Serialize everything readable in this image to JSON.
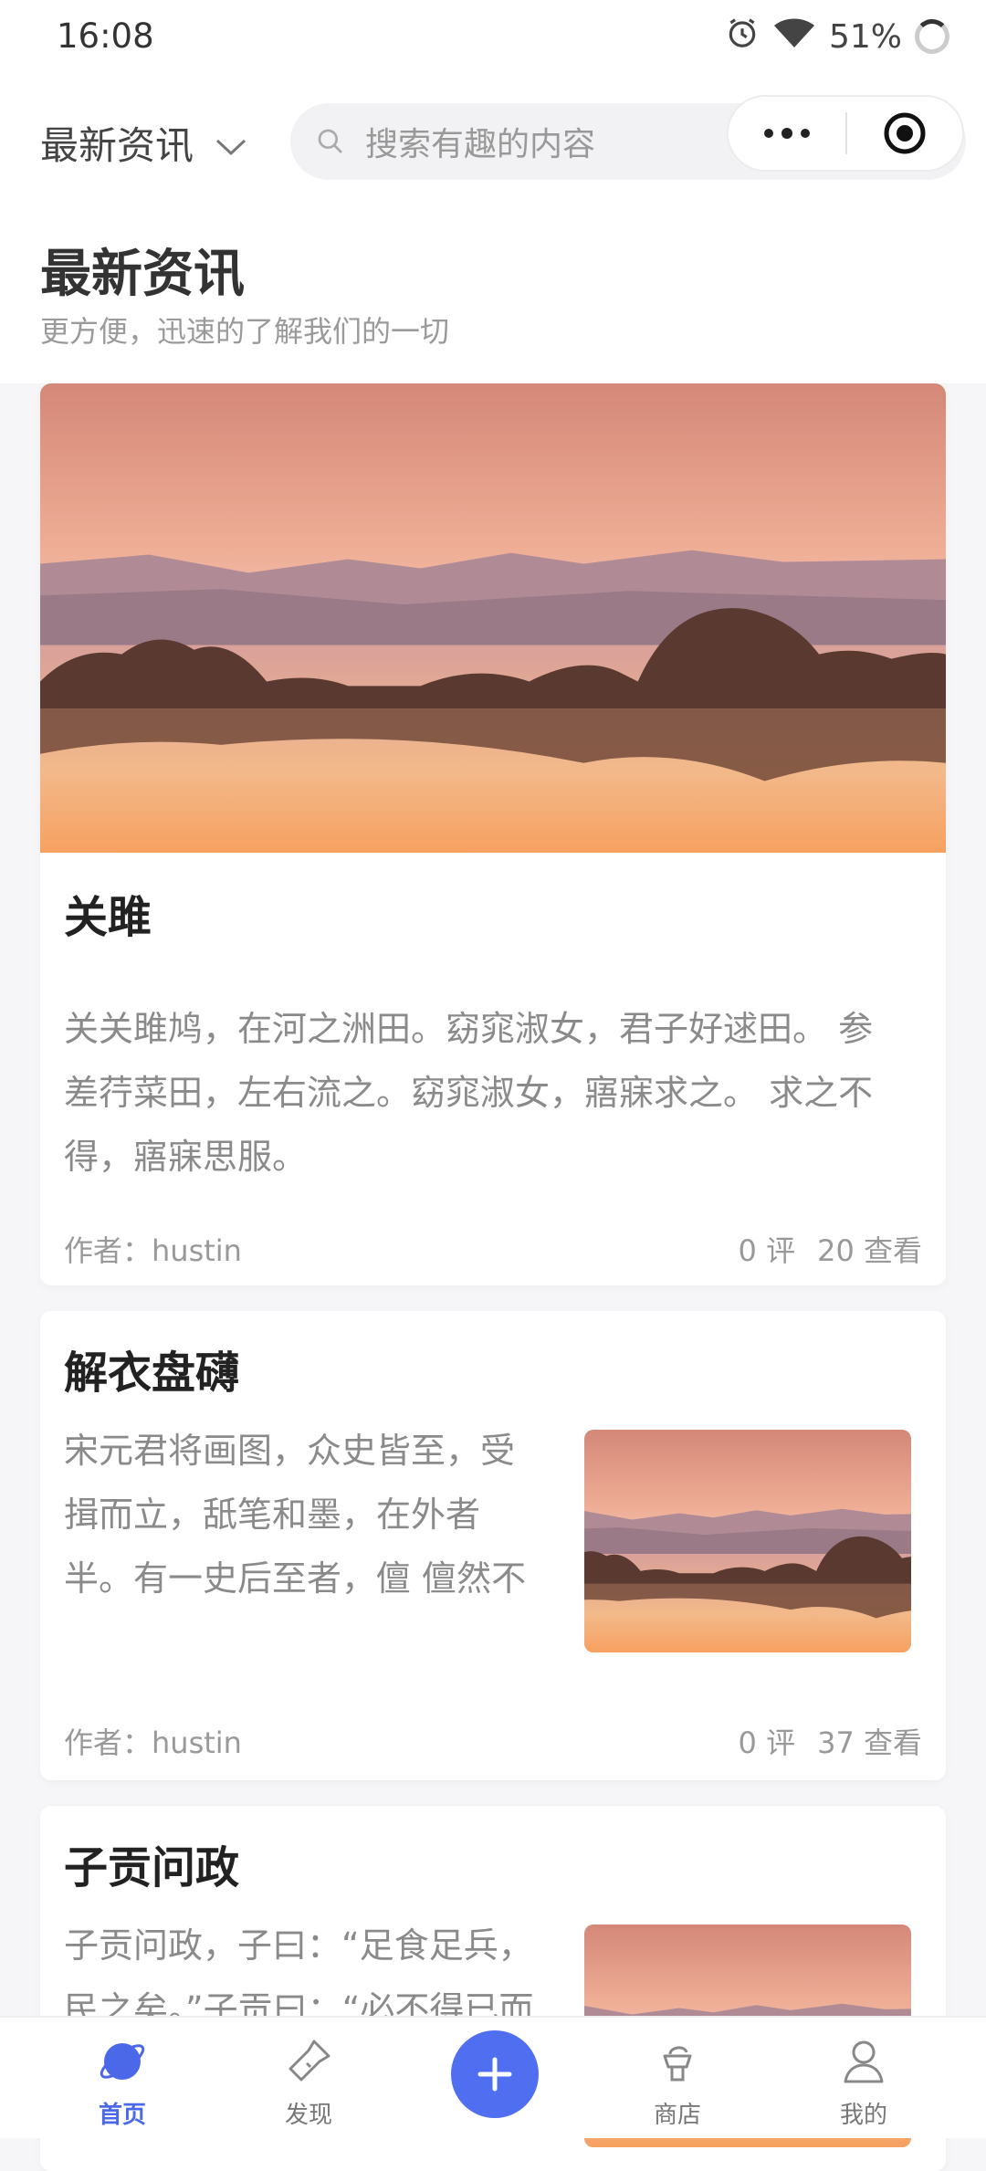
{
  "status_bar": {
    "time": "16:08",
    "battery": "51%"
  },
  "top_bar": {
    "channel_label": "最新资讯",
    "search_placeholder": "搜索有趣的内容"
  },
  "header": {
    "title": "最新资讯",
    "subtitle": "更方便，迅速的了解我们的一切"
  },
  "articles": [
    {
      "title": "关雎",
      "excerpt_lines": [
        "关关雎鸠，在河之洲田。窈窕淑女，君子好逑田。 参",
        "差荇菜田，左右流之。窈窕淑女，寤寐求之。 求之不",
        "得，寤寐思服。"
      ],
      "author": "作者：hustin",
      "comments": "0 评",
      "views": "20 查看"
    },
    {
      "title": "解衣盘礴",
      "excerpt_lines": [
        "宋元君将画图，众史皆至，受",
        "揖而立，舐笔和墨，在外者",
        "半。有一史后至者，儃 儃然不"
      ],
      "author": "作者：hustin",
      "comments": "0 评",
      "views": "37 查看"
    },
    {
      "title": "子贡问政",
      "excerpt_lines": [
        "子贡问政，子曰：“足食足兵，",
        "民之矣。”子贡曰：“必不得已而"
      ]
    }
  ],
  "tabs": [
    {
      "label": "首页",
      "icon": "planet-icon"
    },
    {
      "label": "发现",
      "icon": "flashlight-icon"
    },
    {
      "label": "",
      "icon": "plus-icon"
    },
    {
      "label": "商店",
      "icon": "shop-icon"
    },
    {
      "label": "我的",
      "icon": "user-icon"
    }
  ],
  "colors": {
    "accent": "#4f6ef0",
    "active_tab": "#4a68e8"
  }
}
